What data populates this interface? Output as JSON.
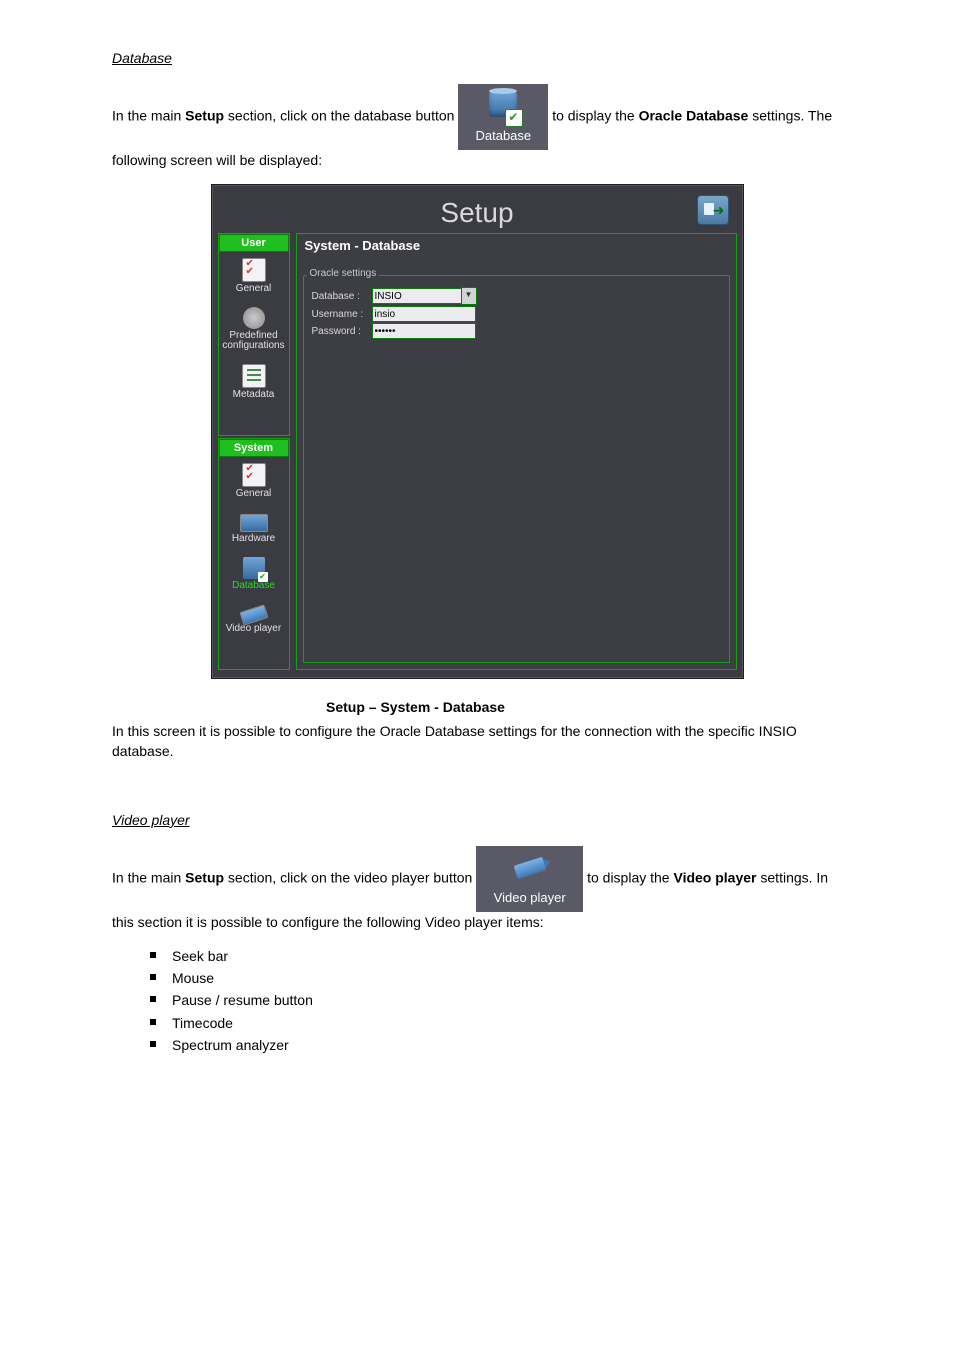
{
  "section1": {
    "title": "Database",
    "intro_pre": "In the main ",
    "intro_post": " section, click on the database button ",
    "setup_word": "Setup",
    "icon_label": "Database",
    "intro_tail1": "to display the ",
    "intro_tail2": " settings. The following screen will be displayed:",
    "oracle_phrase": "Oracle Database"
  },
  "setup_window": {
    "title": "Setup",
    "panel_title": "System - Database",
    "fieldset": "Oracle settings",
    "fields": {
      "database_label": "Database :",
      "database_value": "INSIO",
      "username_label": "Username :",
      "username_value": "insio",
      "password_label": "Password :",
      "password_value": "••••••"
    },
    "sidebar": {
      "user_header": "User",
      "system_header": "System",
      "items_user": [
        {
          "label": "General"
        },
        {
          "label": "Predefined configurations"
        },
        {
          "label": "Metadata"
        }
      ],
      "items_system": [
        {
          "label": "General"
        },
        {
          "label": "Hardware"
        },
        {
          "label": "Database"
        },
        {
          "label": "Video player"
        }
      ]
    }
  },
  "figure_caption": "Setup – System - Database",
  "after_figure": "In this screen it is possible to configure the Oracle Database settings for the connection with the specific INSIO database.",
  "section2": {
    "title": "Video player",
    "intro_pre": "In the main ",
    "setup_word": "Setup",
    "intro_post": " section, click on the video player button ",
    "icon_label": "Video player",
    "intro_tail1": "to display the ",
    "bold_phrase": "Video player",
    "intro_tail2": " settings. In this section it is possible to configure the following Video player items:",
    "bullets": [
      "Seek bar",
      "Mouse",
      "Pause / resume button",
      "Timecode",
      "Spectrum analyzer"
    ]
  }
}
